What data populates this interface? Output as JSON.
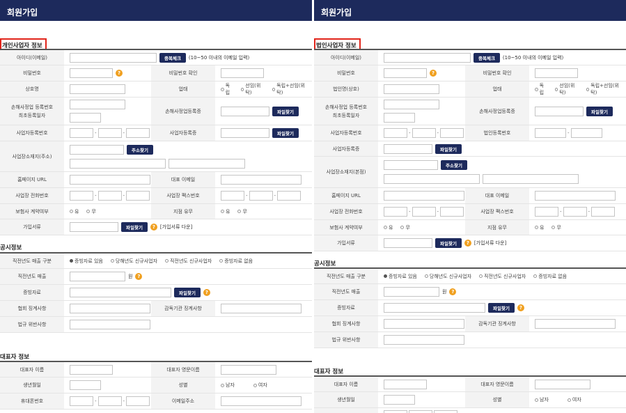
{
  "left": {
    "title": "회원가입",
    "section1": "개인사업자 정보",
    "id_label": "아이디(이메일)",
    "dup_check": "중복체크",
    "id_hint": "(10~50 이내의 이메일 입력)",
    "pw_label": "비밀번호",
    "pw_confirm_label": "비밀번호 확인",
    "company_label": "상호명",
    "biz_type_label": "업태",
    "biz_opts": [
      "독립",
      "선임(위탁)",
      "독립+선임(위탁)"
    ],
    "reg_label_1": "손해사정업 등록번호",
    "reg_label_2": "최초등록일자",
    "reg_cert_label": "손해사정업등록증",
    "file_btn": "파일찾기",
    "bizno_label": "사업자등록번호",
    "bizcert_label": "사업자등록증",
    "addr_label": "사업장소재지(주소)",
    "addr_btn": "주소찾기",
    "homepage_label": "홈페이지 URL",
    "rep_email_label": "대표 이메일",
    "phone_label": "사업장 전화번호",
    "fax_label": "사업장 팩스번호",
    "contract_label": "보험사 계약여부",
    "yes": "유",
    "no": "무",
    "branch_label": "지점 유무",
    "docs_label": "가입서류",
    "docs_link": "[가입서류 다운]",
    "section2": "공시정보",
    "sales_type_label": "직전년도 매출 구분",
    "sales_opts": [
      "증빙자료 있음",
      "당해년도 신규사업자",
      "직전년도 신규사업자",
      "증빙자료 없음"
    ],
    "sales_label": "직전년도 매출",
    "won": "원",
    "proof_label": "증빙자료",
    "assoc_label": "협회 징계사항",
    "super_label": "감독기관 징계사항",
    "law_label": "법규 위반사항",
    "section3": "대표자 정보",
    "rep_name_label": "대표자 이름",
    "rep_eng_label": "대표자 영문이름",
    "birth_label": "생년월일",
    "gender_label": "성별",
    "male": "남자",
    "female": "여자",
    "mobile_label": "휴대폰번호",
    "email_label": "이메일주소"
  },
  "right": {
    "title": "회원가입",
    "section1": "법인사업자 정보",
    "id_label": "아이디(이메일)",
    "dup_check": "중복체크",
    "id_hint": "(10~50 이내의 이메일 입력)",
    "pw_label": "비밀번호",
    "pw_confirm_label": "비밀번호 확인",
    "company_label": "법인명(상호)",
    "biz_type_label": "업태",
    "biz_opts": [
      "독립",
      "선임(위탁)",
      "독립+선임(위탁)"
    ],
    "reg_label_1": "손해사정업 등록번호",
    "reg_label_2": "최초등록일자",
    "reg_cert_label": "손해사정업등록증",
    "file_btn": "파일찾기",
    "bizno_label": "사업자등록번호",
    "corpno_label": "법인등록번호",
    "bizcert_label": "사업자등록증",
    "addr_label": "사업장소재지(본점)",
    "addr_btn": "주소찾기",
    "homepage_label": "홈페이지 URL",
    "rep_email_label": "대표 이메일",
    "phone_label": "사업장 전화번호",
    "fax_label": "사업장 팩스번호",
    "contract_label": "보험사 계약여부",
    "yes": "유",
    "no": "무",
    "branch_label": "지점 유무",
    "docs_label": "가입서류",
    "docs_link": "[가입서류 다운]",
    "section2": "공시정보",
    "sales_type_label": "직전년도 매출 구분",
    "sales_opts": [
      "증빙자료 있음",
      "당해년도 신규사업자",
      "직전년도 신규사업자",
      "증빙자료 없음"
    ],
    "sales_label": "직전년도 매출",
    "won": "원",
    "proof_label": "증빙자료",
    "assoc_label": "협회 징계사항",
    "super_label": "감독기관 징계사항",
    "law_label": "법규 위반사항",
    "section3": "대표자 정보",
    "rep_name_label": "대표자 이름",
    "rep_eng_label": "대표자 영문이름",
    "birth_label": "생년월일",
    "gender_label": "성별",
    "male": "남자",
    "female": "여자"
  }
}
